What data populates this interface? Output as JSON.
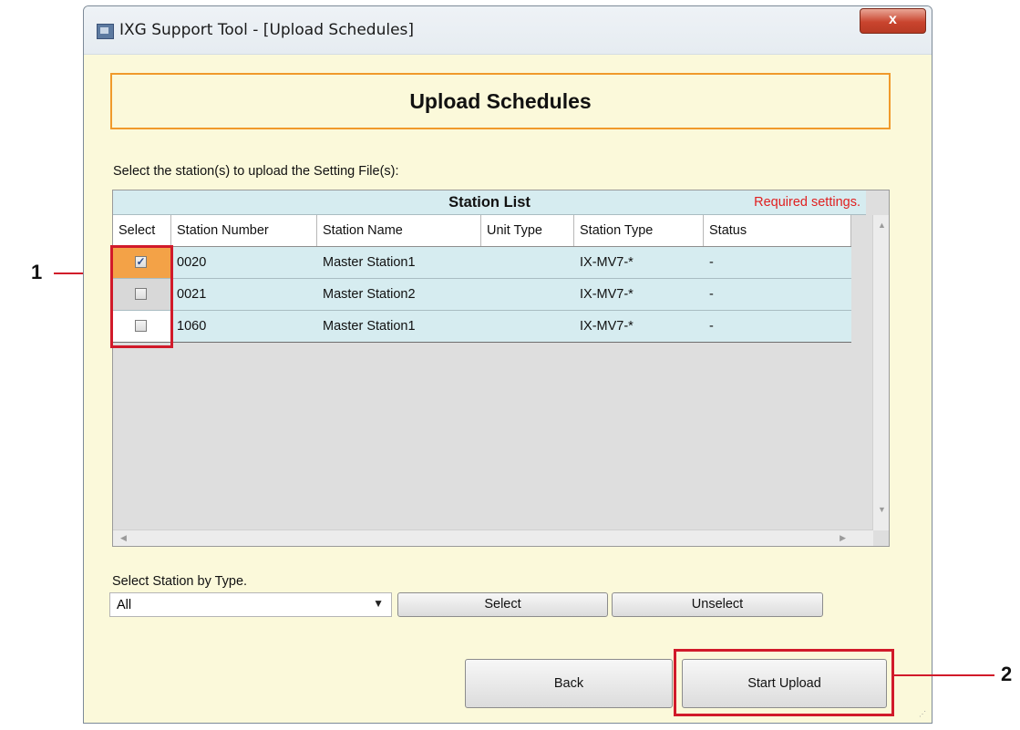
{
  "window": {
    "title": "IXG Support Tool - [Upload Schedules]",
    "close_label": "x"
  },
  "header": {
    "title": "Upload Schedules"
  },
  "instruction": "Select the station(s) to upload the Setting File(s):",
  "station_list": {
    "title": "Station List",
    "required_note": "Required settings.",
    "columns": [
      "Select",
      "Station Number",
      "Station Name",
      "Unit Type",
      "Station Type",
      "Status"
    ],
    "rows": [
      {
        "checked": true,
        "number": "0020",
        "name": "Master Station1",
        "unit_type": "",
        "station_type": "IX-MV7-*",
        "status": "-"
      },
      {
        "checked": false,
        "number": "0021",
        "name": "Master Station2",
        "unit_type": "",
        "station_type": "IX-MV7-*",
        "status": "-"
      },
      {
        "checked": false,
        "number": "1060",
        "name": "Master Station1",
        "unit_type": "",
        "station_type": "IX-MV7-*",
        "status": "-"
      }
    ]
  },
  "type_select": {
    "label": "Select Station by Type.",
    "value": "All"
  },
  "buttons": {
    "select": "Select",
    "unselect": "Unselect",
    "back": "Back",
    "start_upload": "Start Upload"
  },
  "callouts": {
    "one": "1",
    "two": "2"
  },
  "colors": {
    "highlight_red": "#d11a2a",
    "accent_orange": "#f09a2b",
    "row_blue": "#d6ecf0",
    "background": "#fbf9da"
  }
}
